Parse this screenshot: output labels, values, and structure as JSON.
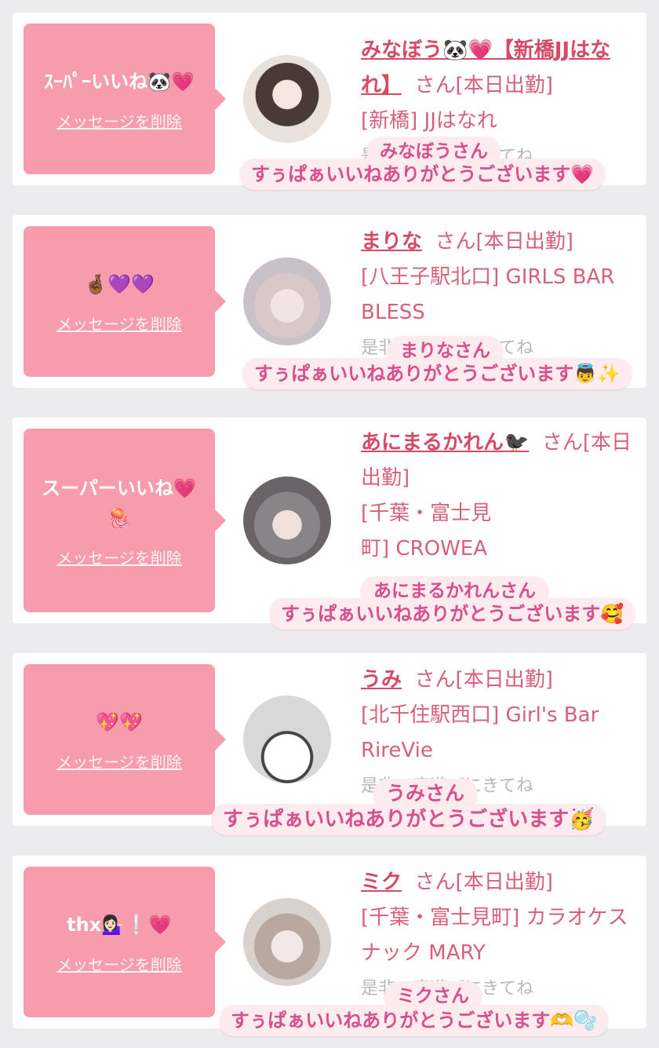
{
  "common": {
    "delete_label": "メッセージを削除",
    "suffix": "さん"
  },
  "cards": [
    {
      "message": "ｽｰﾊﾟｰいいね🐼💗",
      "name": "みなぼう🐼💗【新橋JJはなれ】",
      "status_line": "さん[本日出勤]",
      "shop": "[新橋] JJはなれ",
      "more": "是非一度遊びにきてね",
      "sticker_name": "みなぼうさん",
      "sticker_thanks": "すぅぱぁいいねありがとうございます💗"
    },
    {
      "message": "🤞🏾💜💜",
      "name": "まりな",
      "status_line": "さん[本日出勤]",
      "shop": "[八王子駅北口] GIRLS BAR BLESS",
      "more": "是非一度遊びにきてね",
      "sticker_name": "まりなさん",
      "sticker_thanks": "すぅぱぁいいねありがとうございます👼✨"
    },
    {
      "message": "スーパーいいね💗🪼",
      "name": "あにまるかれん🐦‍⬛",
      "status_line": "さん[本日出勤]",
      "shop": "[千葉・富士見町] CROWEA",
      "more": "",
      "sticker_name": "あにまるかれんさん",
      "sticker_thanks": "すぅぱぁいいねありがとうございます🥰"
    },
    {
      "message": "💖💖",
      "name": "うみ",
      "status_line": "さん[本日出勤]",
      "shop": "[北千住駅西口] Girl's Bar RireVie",
      "more": "是非一度遊びにきてね",
      "sticker_name": "うみさん",
      "sticker_thanks": "すぅぱぁいいねありがとうございます🥳"
    },
    {
      "message": "thx💁🏻‍♀️❕💗",
      "name": "ミク",
      "status_line": "さん[本日出勤]",
      "shop": "[千葉・富士見町] カラオケスナック MARY",
      "more": "是非一度遊びにきてね",
      "sticker_name": "ミクさん",
      "sticker_thanks": "すぅぱぁいいねありがとうございます🫶🫧"
    }
  ],
  "colors": {
    "bubble": "#f79cac",
    "name": "#d64a68",
    "sticker_text": "#d94e8c",
    "sticker_bg": "#fcecef"
  }
}
